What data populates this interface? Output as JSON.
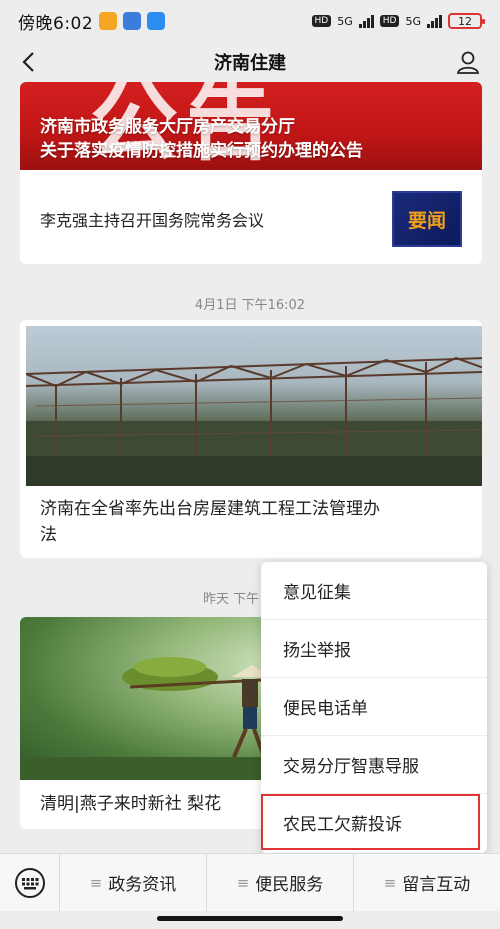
{
  "status_bar": {
    "time": "傍晚6:02",
    "hd1": "HD",
    "net1": "5G",
    "hd2": "HD",
    "net2": "5G",
    "battery": "12"
  },
  "nav": {
    "title": "济南住建",
    "back_icon": "chevron-left-icon",
    "user_icon": "user-icon"
  },
  "feed": {
    "item1": {
      "headline_line1": "济南市政务服务大厅房产交易分厅",
      "headline_line2": "关于落实疫情防控措施实行预约办理的公告",
      "sub_title": "李克强主持召开国务院常务会议",
      "thumb_label": "要闻"
    },
    "timestamp2": "4月1日 下午16:02",
    "item2": {
      "title_line1": "济南在全省率先出台房屋建筑工程工法管理办",
      "title_line2": "法"
    },
    "timestamp3": "昨天 下午",
    "item3": {
      "title": "清明|燕子来时新社 梨花"
    }
  },
  "popup_menu": {
    "items": [
      {
        "label": "意见征集"
      },
      {
        "label": "扬尘举报"
      },
      {
        "label": "便民电话单"
      },
      {
        "label": "交易分厅智惠导服"
      },
      {
        "label": "农民工欠薪投诉"
      }
    ]
  },
  "tab_bar": {
    "keyboard_icon": "keyboard-icon",
    "tabs": [
      {
        "label": "政务资讯",
        "glyph": "≡"
      },
      {
        "label": "便民服务",
        "glyph": "≡"
      },
      {
        "label": "留言互动",
        "glyph": "≡"
      }
    ]
  }
}
